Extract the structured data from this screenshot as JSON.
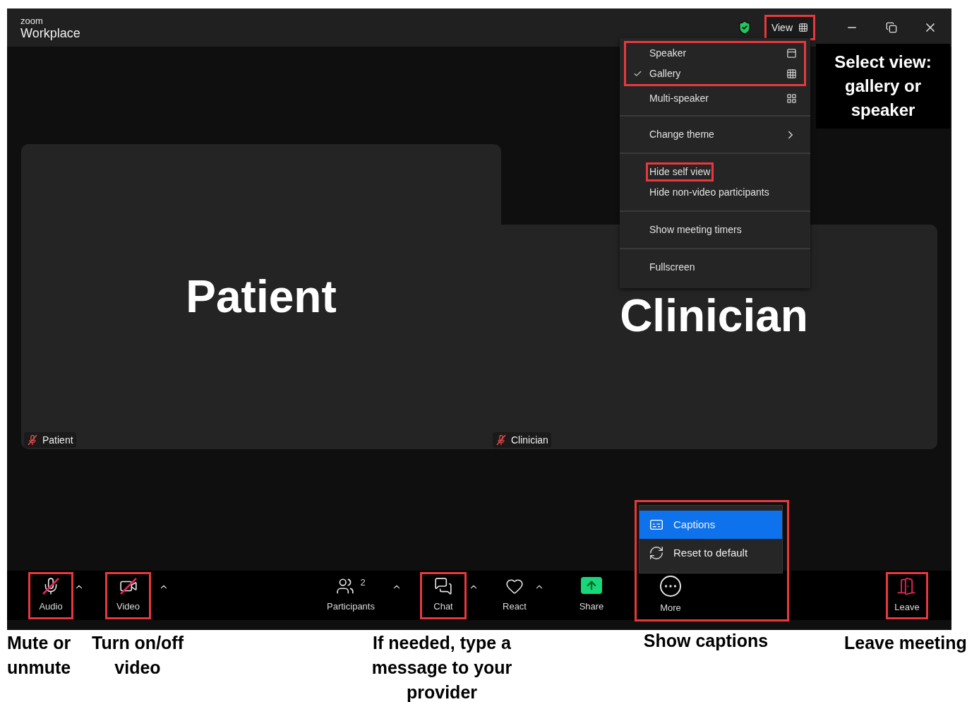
{
  "title_bar": {
    "brand_small": "zoom",
    "brand": "Workplace",
    "view_button": {
      "label": "View",
      "highlighted": true
    }
  },
  "view_menu": {
    "sections": [
      {
        "groups": [
          {
            "highlighted": true,
            "items": [
              {
                "label": "Speaker",
                "kind": "speaker",
                "checked": false,
                "highlighted": false
              },
              {
                "label": "Gallery",
                "kind": "gallery",
                "checked": true,
                "highlighted": false
              }
            ]
          },
          {
            "highlighted": false,
            "items": [
              {
                "label": "Multi-speaker",
                "kind": "multi",
                "checked": false,
                "highlighted": false
              }
            ]
          }
        ]
      },
      {
        "groups": [
          {
            "highlighted": false,
            "items": [
              {
                "label": "Change theme",
                "kind": "submenu",
                "checked": false,
                "highlighted": false
              }
            ]
          }
        ]
      },
      {
        "groups": [
          {
            "highlighted": false,
            "items": [
              {
                "label": "Hide self view",
                "kind": "plain",
                "checked": false,
                "highlighted": true
              },
              {
                "label": "Hide non-video participants",
                "kind": "plain",
                "checked": false,
                "highlighted": false
              }
            ]
          }
        ]
      },
      {
        "groups": [
          {
            "highlighted": false,
            "items": [
              {
                "label": "Show meeting timers",
                "kind": "plain",
                "checked": false,
                "highlighted": false
              }
            ]
          }
        ]
      },
      {
        "groups": [
          {
            "highlighted": false,
            "items": [
              {
                "label": "Fullscreen",
                "kind": "plain",
                "checked": false,
                "highlighted": false
              }
            ]
          }
        ]
      }
    ]
  },
  "tiles": [
    {
      "display_name": "Patient",
      "name_tag": "Patient",
      "muted": true
    },
    {
      "display_name": "Clinician",
      "name_tag": "Clinician",
      "muted": true
    }
  ],
  "more_menu": {
    "highlighted": true,
    "items": [
      {
        "label": "Captions",
        "kind": "captions",
        "selected": true
      },
      {
        "label": "Reset to default",
        "kind": "reset",
        "selected": false
      }
    ]
  },
  "toolbar": [
    {
      "label": "Audio",
      "kind": "audio",
      "muted": true,
      "caret": true,
      "highlighted": true
    },
    {
      "label": "Video",
      "kind": "video",
      "muted": true,
      "caret": true,
      "highlighted": true
    },
    {
      "label": "Participants",
      "kind": "participants",
      "count": "2",
      "caret": true,
      "highlighted": false
    },
    {
      "label": "Chat",
      "kind": "chat",
      "caret": true,
      "highlighted": true
    },
    {
      "label": "React",
      "kind": "react",
      "caret": true,
      "highlighted": false
    },
    {
      "label": "Share",
      "kind": "share",
      "caret": false,
      "highlighted": false
    },
    {
      "label": "More",
      "kind": "more",
      "caret": false,
      "highlighted": false
    },
    {
      "label": "Leave",
      "kind": "leave",
      "caret": false,
      "highlighted": true
    }
  ],
  "annotations": [
    {
      "text": "Select view: gallery or speaker",
      "kind": "dark"
    },
    {
      "text": "Mute or unmute",
      "kind": "plain"
    },
    {
      "text": "Turn on/off video",
      "kind": "plain"
    },
    {
      "text": "If needed, type a message to your provider",
      "kind": "plain"
    },
    {
      "text": "Show captions",
      "kind": "plain"
    },
    {
      "text": "Leave meeting",
      "kind": "plain"
    }
  ]
}
